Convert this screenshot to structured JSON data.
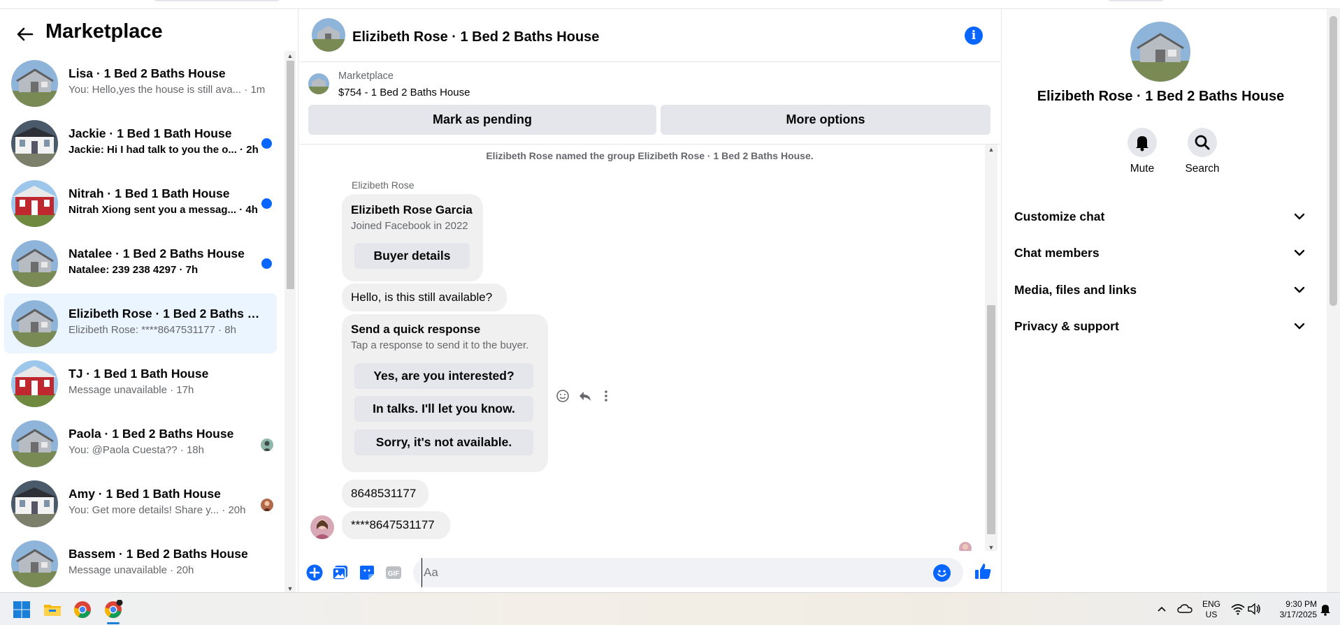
{
  "sidebar": {
    "title": "Marketplace",
    "conversations": [
      {
        "name": "Lisa · 1 Bed 2 Baths House",
        "preview": "You: Hello,yes the house is still ava...",
        "time": "1m",
        "unread": false,
        "thumb": "gray-house"
      },
      {
        "name": "Jackie · 1 Bed 1 Bath House",
        "preview": "Jackie: Hi I had talk to you the o...",
        "time": "2h",
        "unread": true,
        "thumb": "white-house"
      },
      {
        "name": "Nitrah · 1 Bed 1 Bath House",
        "preview": "Nitrah Xiong sent you a messag...",
        "time": "4h",
        "unread": true,
        "thumb": "red-house"
      },
      {
        "name": "Natalee · 1 Bed 2 Baths House",
        "preview": "Natalee: 239 238 4297",
        "time": "7h",
        "unread": true,
        "thumb": "gray-house"
      },
      {
        "name": "Elizibeth Rose · 1 Bed 2 Baths H...",
        "preview": "Elizibeth Rose: ****8647531177",
        "time": "8h",
        "unread": false,
        "thumb": "gray-house",
        "active": true
      },
      {
        "name": "TJ · 1 Bed 1 Bath House",
        "preview": "Message unavailable",
        "time": "17h",
        "unread": false,
        "thumb": "red-house"
      },
      {
        "name": "Paola · 1 Bed 2 Baths House",
        "preview": "You: @Paola Cuesta??",
        "time": "18h",
        "unread": false,
        "thumb": "gray-house"
      },
      {
        "name": "Amy · 1 Bed 1 Bath House",
        "preview": "You: Get more details! Share y...",
        "time": "20h",
        "unread": false,
        "thumb": "white-house"
      },
      {
        "name": "Bassem · 1 Bed 2 Baths House",
        "preview": "Message unavailable",
        "time": "20h",
        "unread": false,
        "thumb": "gray-house"
      }
    ]
  },
  "chat": {
    "title": "Elizibeth Rose · 1 Bed 2 Baths House",
    "listing": {
      "label": "Marketplace",
      "price_line": "$754 - 1 Bed 2 Baths House",
      "mark_pending": "Mark as pending",
      "more_options": "More options"
    },
    "system_message": "Elizibeth Rose named the group Elizibeth Rose · 1 Bed 2 Baths House.",
    "sender_name": "Elizibeth Rose",
    "profile_card": {
      "name": "Elizibeth Rose Garcia",
      "joined": "Joined Facebook in 2022",
      "button": "Buyer details"
    },
    "message_1": "Hello, is this still available?",
    "quick_response": {
      "title": "Send a quick response",
      "subtitle": "Tap a response to send it to the buyer.",
      "options": [
        "Yes, are you interested?",
        "In talks. I'll let you know.",
        "Sorry, it's not available."
      ]
    },
    "message_2": "8648531177",
    "message_3": "****8647531177",
    "composer_placeholder": "Aa"
  },
  "right_panel": {
    "title": "Elizibeth Rose · 1 Bed 2 Baths House",
    "mute": "Mute",
    "search": "Search",
    "sections": [
      "Customize chat",
      "Chat members",
      "Media, files and links",
      "Privacy & support"
    ]
  },
  "taskbar": {
    "lang_1": "ENG",
    "lang_2": "US",
    "time": "9:30 PM",
    "date": "3/17/2025"
  },
  "colors": {
    "accent": "#0866ff",
    "active_row": "#ebf5ff",
    "bubble": "#f0f0f0",
    "button": "#e4e6eb",
    "secondary_text": "#65676b"
  }
}
